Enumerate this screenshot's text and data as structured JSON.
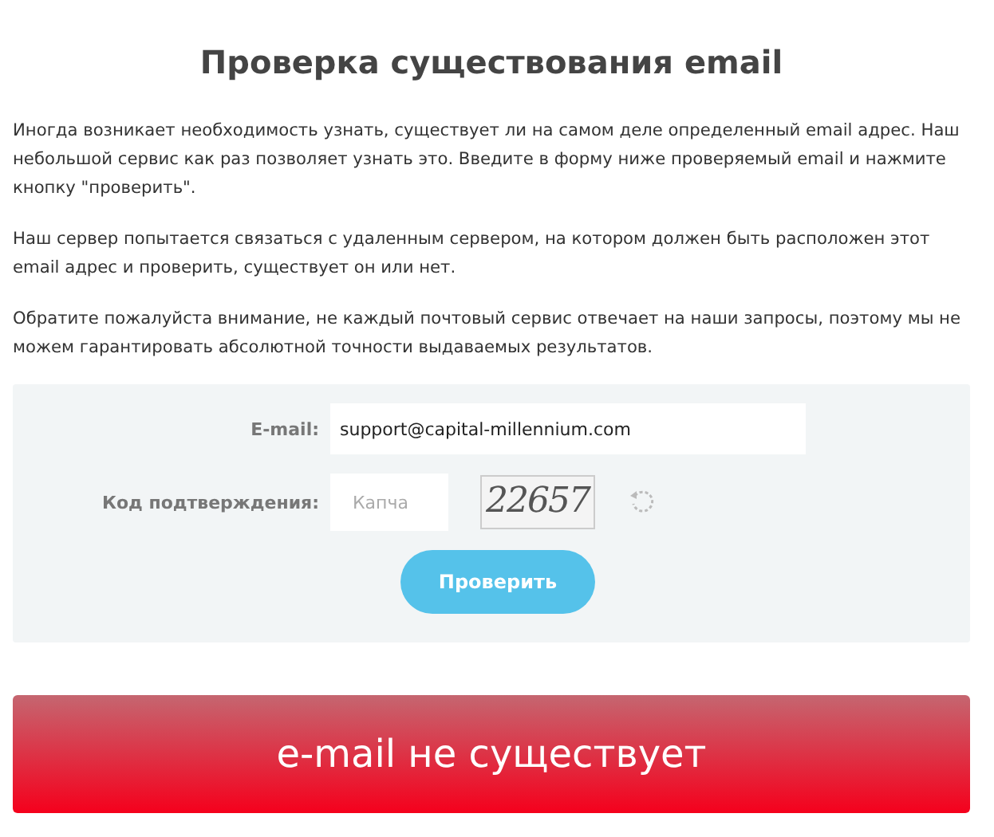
{
  "title": "Проверка существования email",
  "paragraphs": [
    "Иногда возникает необходимость узнать, существует ли на самом деле определенный email адрес. Наш небольшой сервис как раз позволяет узнать это. Введите в форму ниже проверяемый email и нажмите кнопку \"проверить\".",
    "Наш сервер попытается связаться с удаленным сервером, на котором должен быть расположен этот email адрес и проверить, существует он или нет.",
    "Обратите пожалуйста внимание, не каждый почтовый сервис отвечает на наши запросы, поэтому мы не можем гарантировать абсолютной точности выдаваемых результатов."
  ],
  "form": {
    "email_label": "E-mail:",
    "email_value": "support@capital-millennium.com",
    "code_label": "Код подтверждения:",
    "code_placeholder": "Капча",
    "captcha": "22657",
    "submit": "Проверить"
  },
  "result": {
    "text": "e-mail не существует",
    "exists": false
  }
}
